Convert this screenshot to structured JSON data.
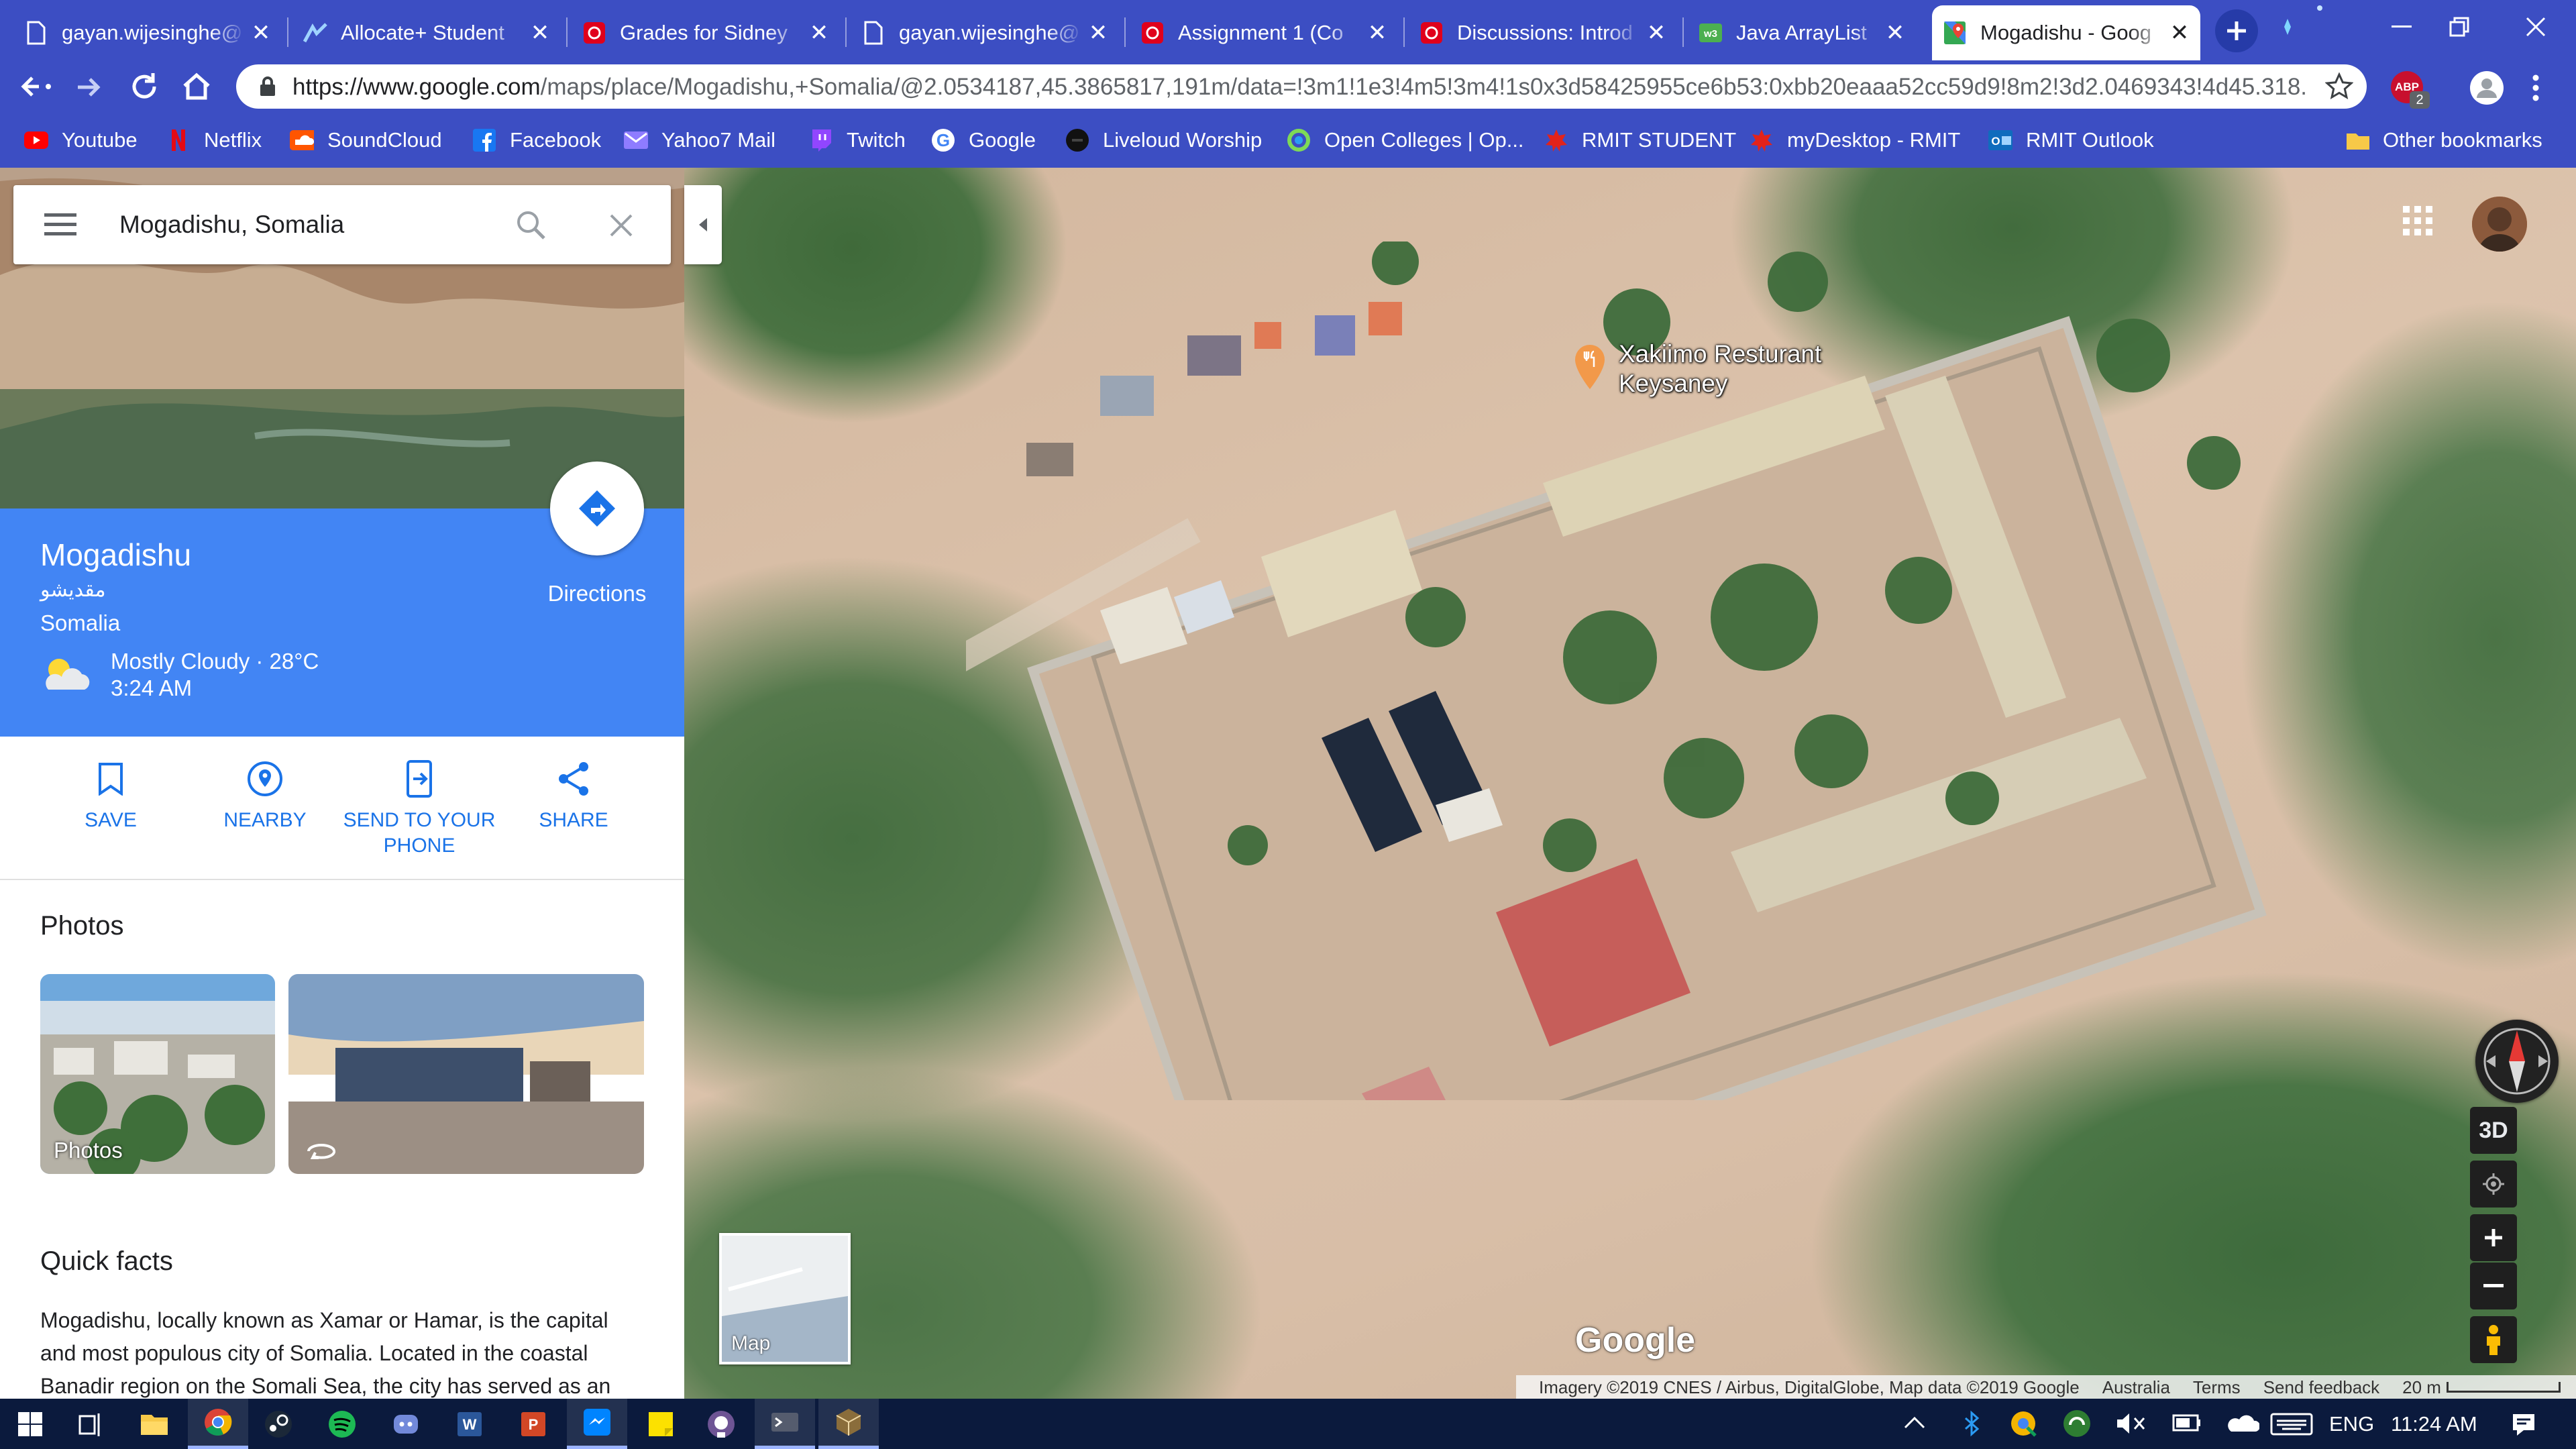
{
  "browser": {
    "tabs": [
      {
        "title": "gayan.wijesinghe@",
        "icon": "document-icon"
      },
      {
        "title": "Allocate+ Student",
        "icon": "allocate-icon"
      },
      {
        "title": "Grades for Sidney",
        "icon": "canvas-icon"
      },
      {
        "title": "gayan.wijesinghe@",
        "icon": "document-icon"
      },
      {
        "title": "Assignment 1 (Co",
        "icon": "canvas-icon"
      },
      {
        "title": "Discussions: Introd",
        "icon": "canvas-icon"
      },
      {
        "title": "Java ArrayList",
        "icon": "w3schools-icon"
      },
      {
        "title": "Mogadishu - Goog",
        "icon": "google-maps-icon"
      }
    ],
    "url_host": "https://www.google.com",
    "url_path": "/maps/place/Mogadishu,+Somalia/@2.0534187,45.3865817,191m/data=!3m1!1e3!4m5!3m4!1s0x3d58425955ce6b53:0xbb20eaaa52cc59d9!8m2!3d2.0469343!4d45.318...",
    "extension_badge": "2",
    "bookmarks": [
      "Youtube",
      "Netflix",
      "SoundCloud",
      "Facebook",
      "Yahoo7 Mail",
      "Twitch",
      "Google",
      "Liveloud Worship",
      "Open Colleges | Op...",
      "RMIT STUDENT",
      "myDesktop - RMIT",
      "RMIT Outlook"
    ],
    "other_bookmarks": "Other bookmarks"
  },
  "sidebar": {
    "search_value": "Mogadishu, Somalia",
    "place_name": "Mogadishu",
    "place_name_alt": "مقديشو",
    "country": "Somalia",
    "weather": "Mostly Cloudy · 28°C",
    "local_time": "3:24 AM",
    "directions_label": "Directions",
    "actions": [
      "SAVE",
      "NEARBY",
      "SEND TO YOUR PHONE",
      "SHARE"
    ],
    "photos_heading": "Photos",
    "photo_label": "Photos",
    "quick_facts_heading": "Quick facts",
    "quick_facts_text": "Mogadishu, locally known as Xamar or Hamar, is the capital and most populous city of Somalia. Located in the coastal Banadir region on the Somali Sea, the city has served as an"
  },
  "map": {
    "poi_name": "Xakiimo Resturant Keysaney",
    "layers_label": "Map",
    "btn_3d": "3D",
    "logo": "Google",
    "attribution": "Imagery ©2019 CNES / Airbus, DigitalGlobe, Map data ©2019 Google",
    "region": "Australia",
    "terms": "Terms",
    "feedback": "Send feedback",
    "scale": "20 m"
  },
  "taskbar": {
    "language": "ENG",
    "time": "11:24 AM"
  },
  "colors": {
    "chrome_blue": "#3c4ec3",
    "maps_blue": "#4285f4",
    "link_blue": "#1a73e8"
  }
}
